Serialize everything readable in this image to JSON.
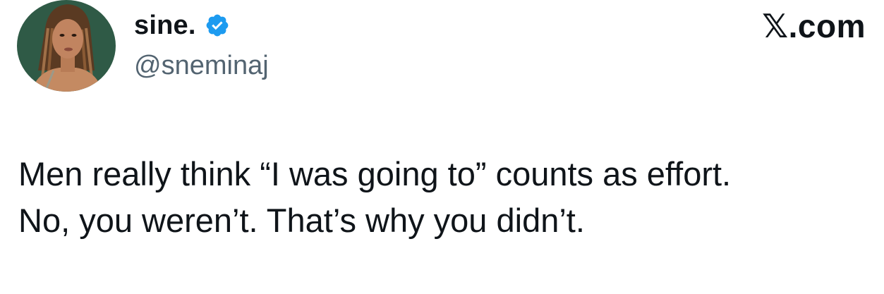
{
  "author": {
    "display_name": "sine.",
    "handle": "@sneminaj",
    "verified": true,
    "avatar_icon": "profile-photo",
    "verified_icon": "verified-badge-icon"
  },
  "source": {
    "label": "𝕏.com"
  },
  "tweet": {
    "lines": [
      "Men really think “I was going to” counts as effort.",
      "No, you weren’t. That’s why you didn’t."
    ]
  },
  "colors": {
    "text": "#0f1419",
    "handle": "#536471",
    "verified": "#1d9bf0",
    "avatar_bg": "#2f5a46"
  }
}
